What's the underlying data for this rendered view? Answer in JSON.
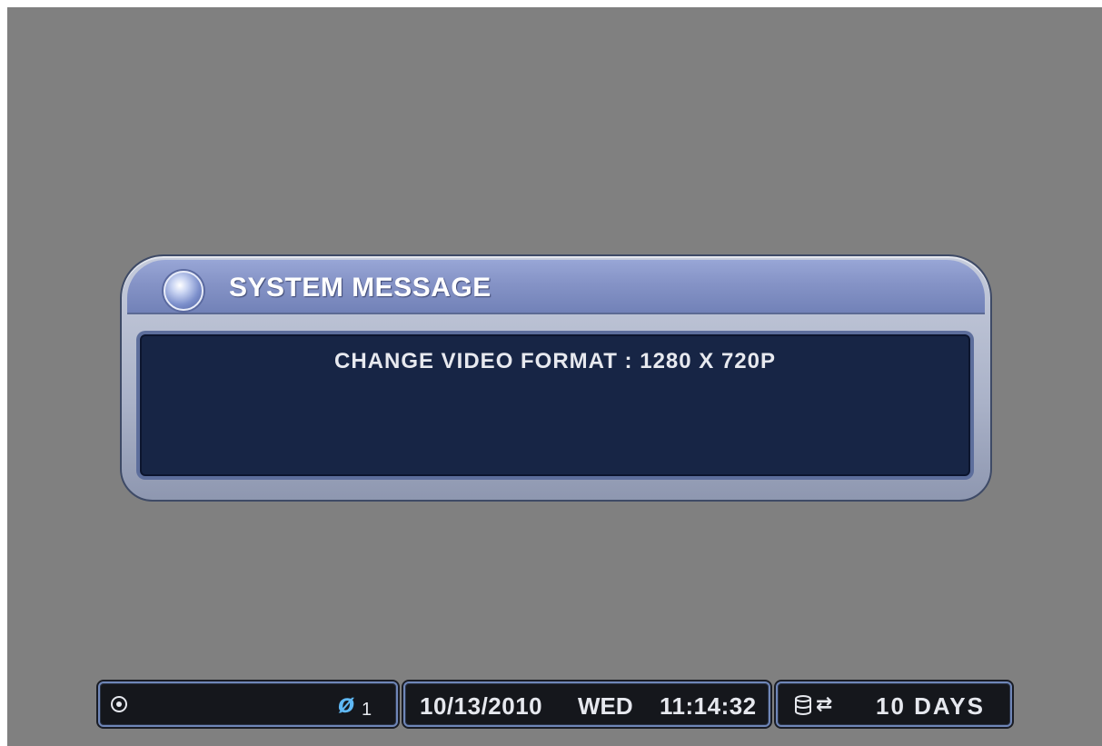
{
  "dialog": {
    "title": "SYSTEM MESSAGE",
    "message": "CHANGE VIDEO FORMAT : 1280 X 720P"
  },
  "status_bar": {
    "camera_glyph": "⊘",
    "no_signal_glyph": "ø",
    "channel": "1",
    "date": "10/13/2010",
    "day": "WED",
    "time": "11:14:32",
    "cycle_glyph": "⇄",
    "retention": "10 DAYS"
  },
  "colors": {
    "screen_background": "#808080",
    "dialog_title_bar": "#8593c6",
    "dialog_body": "#172545",
    "no_signal_accent": "#5fb8f4"
  },
  "icons": {
    "camera": "eye-icon",
    "no_signal": "no-signal-icon",
    "disk": "disk-icon",
    "cycle": "cycle-icon"
  }
}
